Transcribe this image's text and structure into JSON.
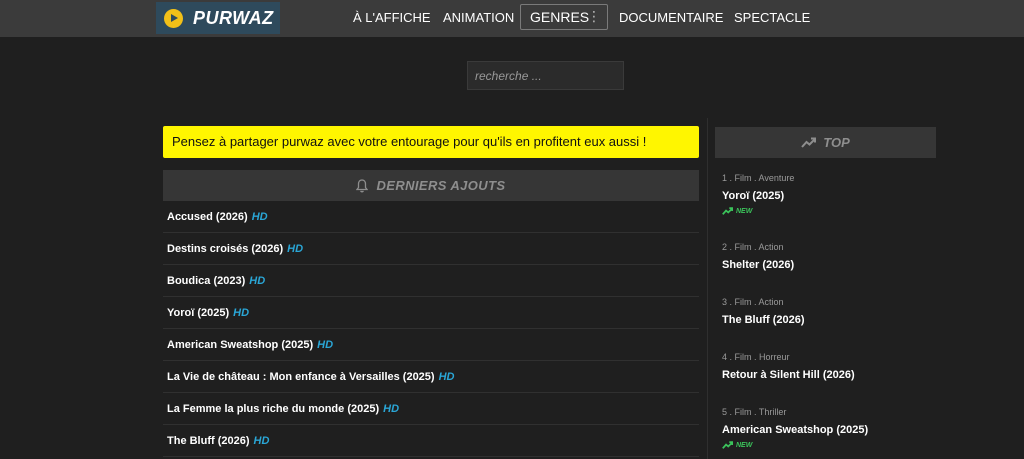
{
  "brand": {
    "name": "PURWAZ"
  },
  "nav": {
    "items": [
      "À L'AFFICHE",
      "ANIMATION",
      "DOCUMENTAIRE",
      "SPECTACLE"
    ],
    "genres_label": "GENRES"
  },
  "search": {
    "placeholder": "recherche ..."
  },
  "banner": {
    "text": "Pensez à partager purwaz avec votre entourage pour qu'ils en profitent eux aussi !"
  },
  "latest": {
    "title": "DERNIERS AJOUTS",
    "badge": "HD",
    "items": [
      "Accused (2026)",
      "Destins croisés (2026)",
      "Boudica (2023)",
      "Yoroï (2025)",
      "American Sweatshop (2025)",
      "La Vie de château : Mon enfance à Versailles (2025)",
      "La Femme la plus riche du monde (2025)",
      "The Bluff (2026)"
    ]
  },
  "top": {
    "title": "TOP",
    "new_label": "NEW",
    "items": [
      {
        "meta": "1 . Film . Aventure",
        "title": "Yoroï (2025)",
        "new": true
      },
      {
        "meta": "2 . Film . Action",
        "title": "Shelter (2026)",
        "new": false
      },
      {
        "meta": "3 . Film . Action",
        "title": "The Bluff (2026)",
        "new": false
      },
      {
        "meta": "4 . Film . Horreur",
        "title": "Retour à Silent Hill (2026)",
        "new": false
      },
      {
        "meta": "5 . Film . Thriller",
        "title": "American Sweatshop (2025)",
        "new": true
      }
    ]
  },
  "colors": {
    "accent_yellow": "#fff600",
    "hd_blue": "#2aa6d6",
    "new_green": "#3bc45b",
    "logo_bg": "#2e4a5c"
  }
}
